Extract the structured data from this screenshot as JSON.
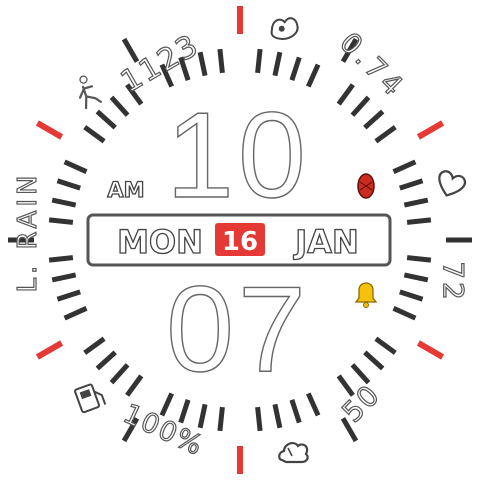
{
  "watch": {
    "hour": "10",
    "minute": "07",
    "ampm": "AM",
    "date": {
      "weekday": "MON",
      "day": "16",
      "month": "JAN"
    },
    "complications": {
      "steps": "1123",
      "distance": "0.74",
      "heart_rate": "72",
      "weather": "L. RAIN",
      "battery": "100%",
      "hour_digit_50": "50"
    },
    "icons": {
      "steps": "walking-person-icon",
      "distance": "running-shoe-icon",
      "heart_rate": "heart-icon",
      "weather": "rain-cloud-icon",
      "battery": "battery-icon",
      "alarm": "bell-icon",
      "notification": "red-bug-icon"
    },
    "colors": {
      "accent": "#e53935",
      "tick": "#333333",
      "bell": "#f4c20d"
    }
  }
}
